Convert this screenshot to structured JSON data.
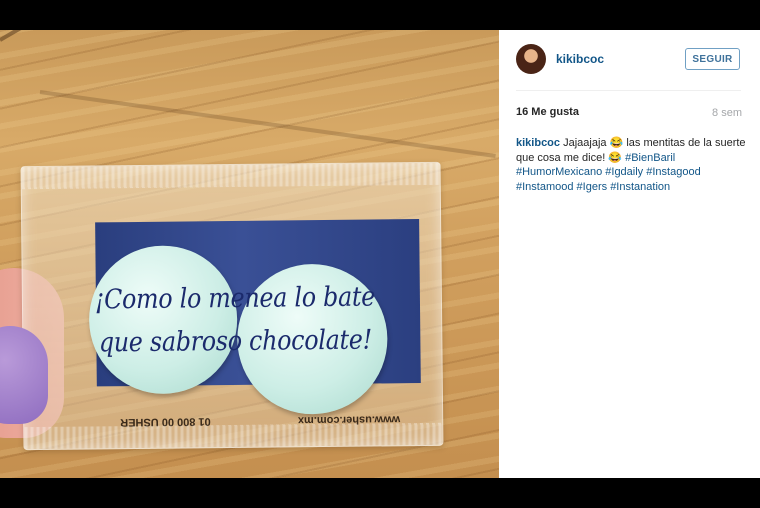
{
  "post": {
    "image": {
      "packet_line_1": "¡Como lo menea lo bate",
      "packet_line_2": "que sabroso chocolate!",
      "packet_phone": "01 800 00 USHER",
      "packet_url": "www.usher.com.mx"
    },
    "header": {
      "username": "kikibcoc",
      "follow_label": "SEGUIR"
    },
    "stats": {
      "likes": "16 Me gusta",
      "timestamp": "8 sem"
    },
    "caption": {
      "username": "kikibcoc",
      "text": "Jajaajaja 😂 las mentitas de la suerte que cosa me dice! 😂",
      "hashtags": [
        "#BienBaril",
        "#HumorMexicano",
        "#Igdaily",
        "#Instagood",
        "#Instamood",
        "#Igers",
        "#Instanation"
      ]
    }
  },
  "colors": {
    "link": "#125688",
    "button_text": "#3f729b",
    "muted": "#a5a7aa"
  }
}
